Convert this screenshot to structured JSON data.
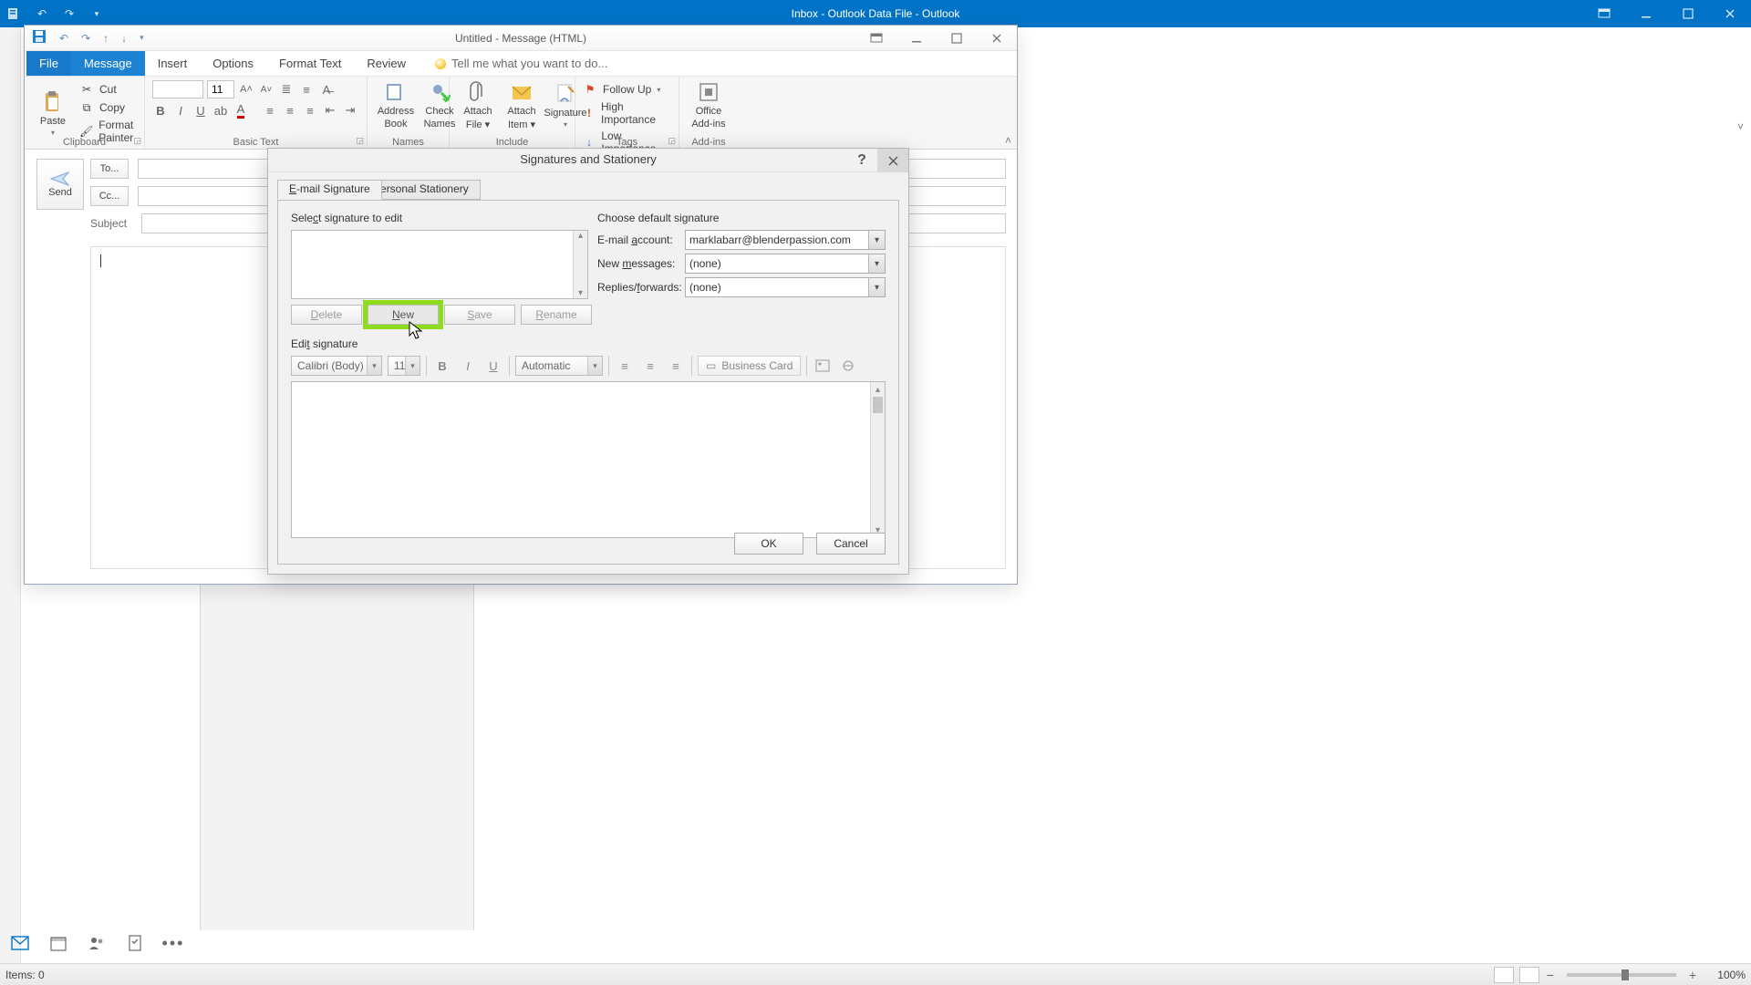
{
  "outlook": {
    "title": "Inbox - Outlook Data File - Outlook",
    "status_items": "Items: 0",
    "zoom": "100%"
  },
  "message_window": {
    "title": "Untitled - Message (HTML)",
    "tabs": {
      "file": "File",
      "message": "Message",
      "insert": "Insert",
      "options": "Options",
      "format": "Format Text",
      "review": "Review",
      "tell": "Tell me what you want to do..."
    },
    "ribbon": {
      "clipboard": {
        "label": "Clipboard",
        "paste": "Paste",
        "cut": "Cut",
        "copy": "Copy",
        "painter": "Format Painter"
      },
      "basictext": {
        "label": "Basic Text",
        "font": "",
        "size": "11"
      },
      "names": {
        "label": "Names",
        "address": "Address",
        "book": "Book",
        "check": "Check",
        "names2": "Names"
      },
      "include": {
        "label": "Include",
        "attachfile": "Attach",
        "file": "File",
        "attachitem": "Attach",
        "item": "Item",
        "signature": "Signature"
      },
      "tags": {
        "label": "Tags",
        "follow": "Follow Up",
        "high": "High Importance",
        "low": "Low Importance"
      },
      "addins": {
        "label": "Add-ins",
        "office": "Office",
        "addins2": "Add-ins"
      }
    },
    "compose": {
      "send": "Send",
      "to": "To...",
      "cc": "Cc...",
      "subject": "Subject"
    }
  },
  "sig_dialog": {
    "title": "Signatures and Stationery",
    "tabs": {
      "email": "E-mail Signature",
      "stationery": "Personal Stationery"
    },
    "select_label": "Select signature to edit",
    "choose_label": "Choose default signature",
    "account_label": "E-mail account:",
    "account_value": "marklabarr@blenderpassion.com",
    "newmsg_label": "New messages:",
    "newmsg_value": "(none)",
    "replies_label": "Replies/forwards:",
    "replies_value": "(none)",
    "buttons": {
      "delete": "Delete",
      "new": "New",
      "save": "Save",
      "rename": "Rename"
    },
    "edit_label": "Edit signature",
    "editor": {
      "font": "Calibri (Body)",
      "size": "11",
      "color": "Automatic",
      "bizcard": "Business Card"
    },
    "footer": {
      "ok": "OK",
      "cancel": "Cancel"
    }
  }
}
